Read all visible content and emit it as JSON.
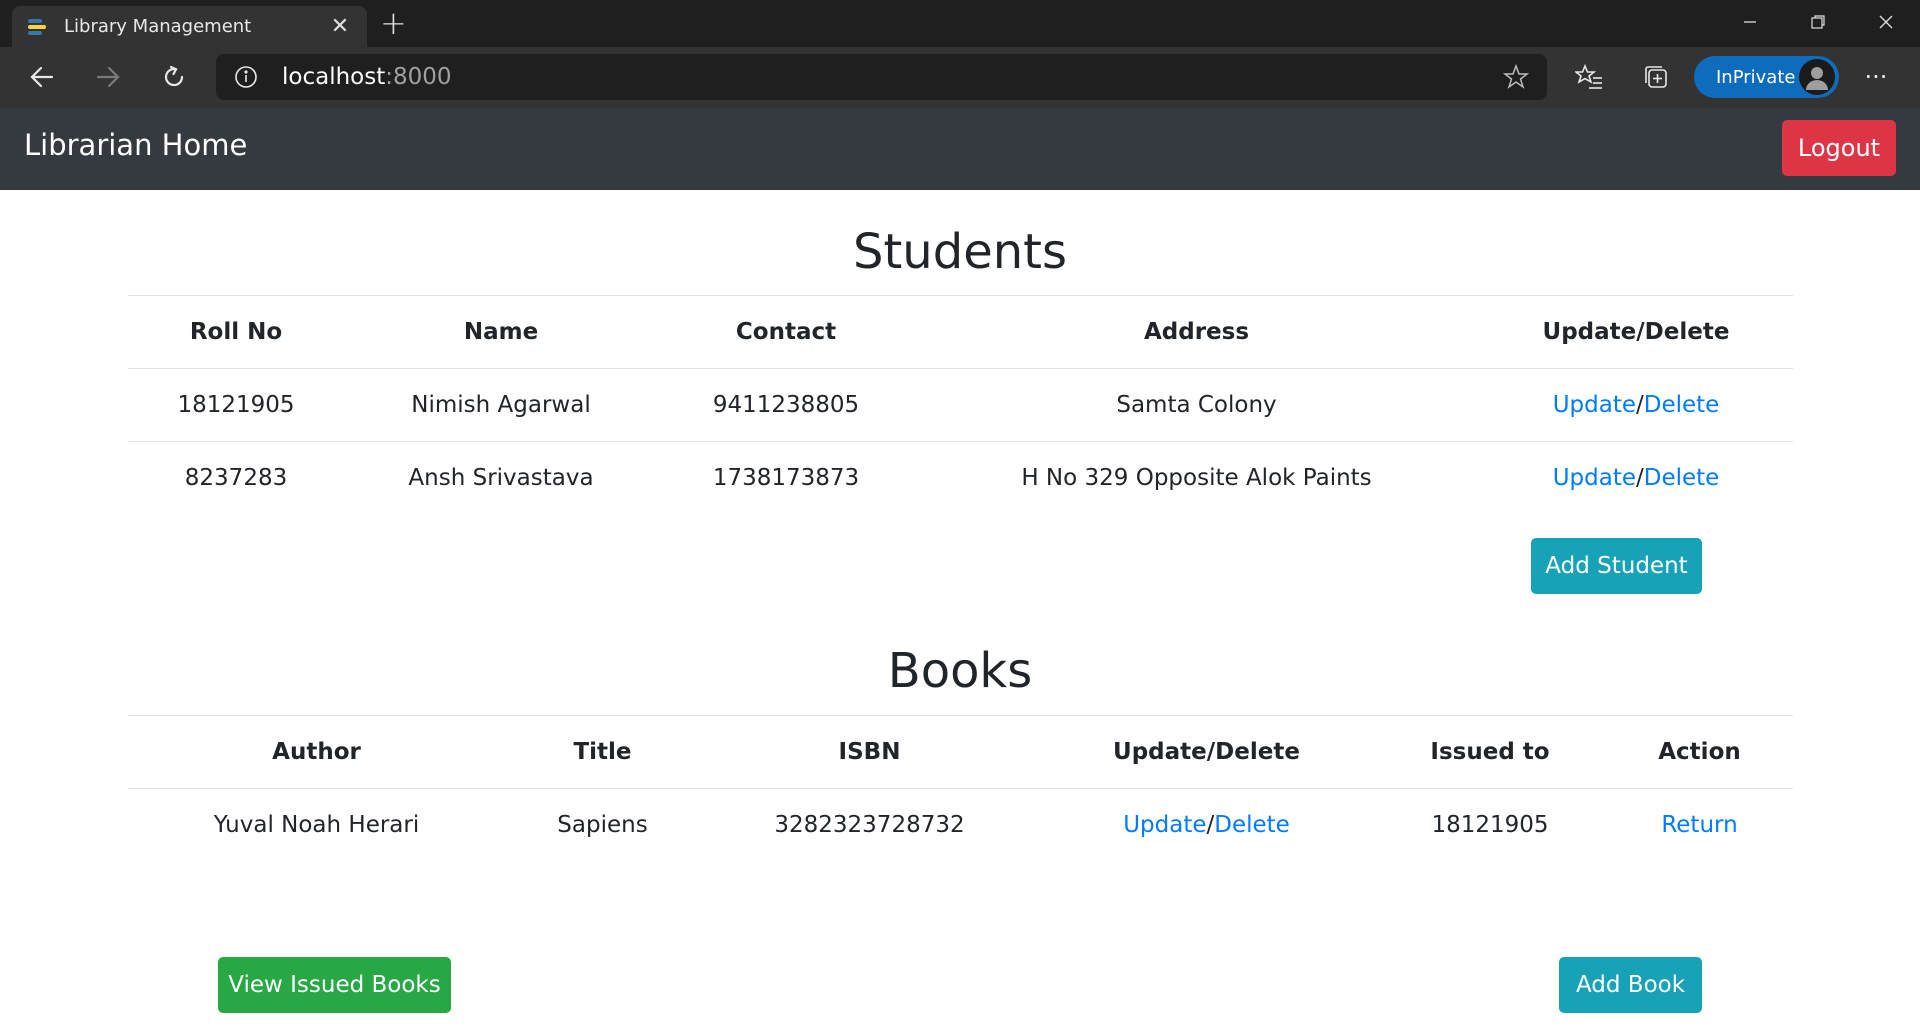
{
  "browser": {
    "tab_title": "Library Management",
    "tab_close": "✕",
    "new_tab": "+",
    "address_host": "localhost",
    "address_port": ":8000",
    "inprivate_label": "InPrivate",
    "more_label": "···"
  },
  "navbar": {
    "brand": "Librarian Home",
    "logout_label": "Logout"
  },
  "students": {
    "title": "Students",
    "headers": [
      "Roll No",
      "Name",
      "Contact",
      "Address",
      "Update/Delete"
    ],
    "rows": [
      {
        "roll": "18121905",
        "name": "Nimish Agarwal",
        "contact": "9411238805",
        "address": "Samta Colony"
      },
      {
        "roll": "8237283",
        "name": "Ansh Srivastava",
        "contact": "1738173873",
        "address": "H No 329 Opposite Alok Paints"
      }
    ],
    "update_label": "Update",
    "slash": "/",
    "delete_label": "Delete",
    "add_label": "Add Student"
  },
  "books": {
    "title": "Books",
    "headers": [
      "Author",
      "Title",
      "ISBN",
      "Update/Delete",
      "Issued to",
      "Action"
    ],
    "rows": [
      {
        "author": "Yuval Noah Herari",
        "title": "Sapiens",
        "isbn": "3282323728732",
        "issued_to": "18121905",
        "action": "Return"
      }
    ],
    "update_label": "Update",
    "slash": "/",
    "delete_label": "Delete",
    "view_issued_label": "View Issued Books",
    "add_label": "Add Book"
  },
  "colors": {
    "navbar_bg": "#343a40",
    "danger": "#dc3545",
    "info": "#17a2b8",
    "success": "#28a745",
    "link": "#007bff"
  }
}
